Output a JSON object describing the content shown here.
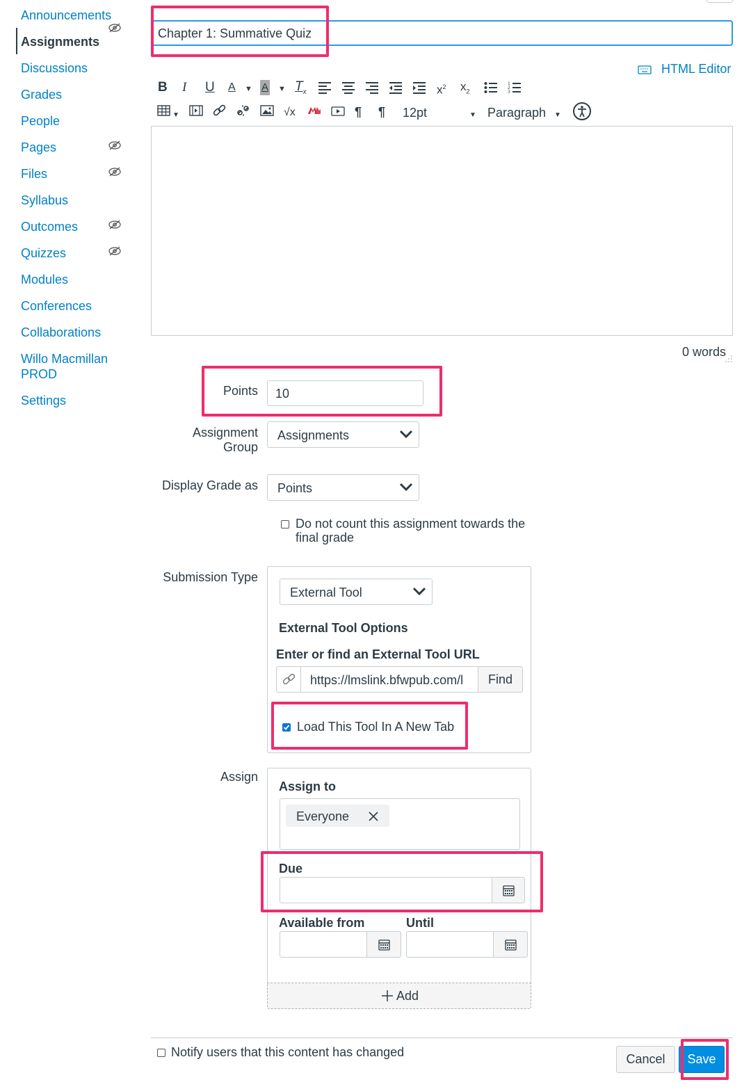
{
  "sidebar": {
    "items": [
      {
        "label": "Announcements"
      },
      {
        "label": "Assignments"
      },
      {
        "label": "Discussions"
      },
      {
        "label": "Grades"
      },
      {
        "label": "People"
      },
      {
        "label": "Pages"
      },
      {
        "label": "Files"
      },
      {
        "label": "Syllabus"
      },
      {
        "label": "Outcomes"
      },
      {
        "label": "Quizzes"
      },
      {
        "label": "Modules"
      },
      {
        "label": "Conferences"
      },
      {
        "label": "Collaborations"
      },
      {
        "label": "Willo Macmillan PROD"
      },
      {
        "label": "Settings"
      }
    ],
    "active": "Assignments",
    "hidden_icon": "eye-slash-icon"
  },
  "title_field": {
    "value": "Chapter 1: Summative Quiz"
  },
  "editor": {
    "html_editor_label": "HTML Editor",
    "font_size": "12pt",
    "block_format": "Paragraph",
    "word_count": "0 words"
  },
  "form": {
    "points": {
      "label": "Points",
      "value": "10"
    },
    "assignment_group": {
      "label_line1": "Assignment",
      "label_line2": "Group",
      "value": "Assignments"
    },
    "display_grade": {
      "label": "Display Grade as",
      "value": "Points"
    },
    "no_count": {
      "label_line1": "Do not count this assignment towards the",
      "label_line2": "final grade",
      "checked": false
    },
    "submission_type": {
      "label": "Submission Type",
      "value": "External Tool",
      "options_heading": "External Tool Options",
      "url_label": "Enter or find an External Tool URL",
      "url_value": "https://lmslink.bfwpub.com/l",
      "find_label": "Find",
      "new_tab_label": "Load This Tool In A New Tab",
      "new_tab_checked": true
    },
    "assign": {
      "label": "Assign",
      "assign_to_label": "Assign to",
      "assignee": "Everyone",
      "due_label": "Due",
      "available_from_label": "Available from",
      "until_label": "Until",
      "add_label": "Add"
    }
  },
  "footer": {
    "notify_label": "Notify users that this content has changed",
    "notify_checked": false,
    "cancel_label": "Cancel",
    "save_label": "Save"
  },
  "colors": {
    "link": "#0081c6",
    "highlight": "#ee2d6a",
    "primary": "#008ee2",
    "text": "#2d3b45"
  }
}
